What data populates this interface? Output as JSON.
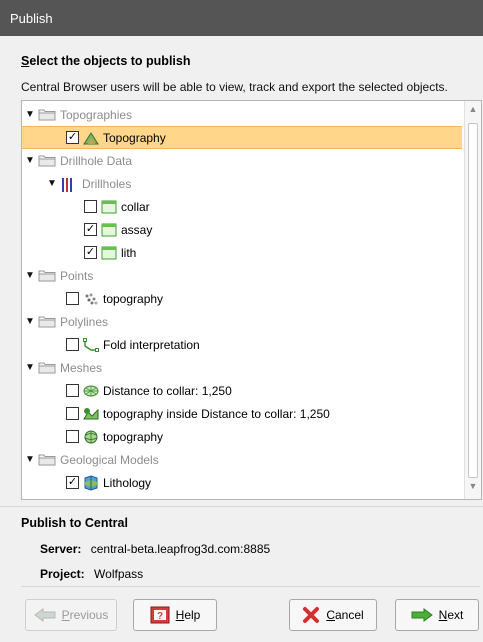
{
  "window": {
    "title": "Publish"
  },
  "heading": {
    "mnemonic": "S",
    "rest": "elect the objects to publish"
  },
  "description": "Central Browser users will be able to view, track and export the selected objects.",
  "tree": [
    {
      "type": "folder",
      "label": "Topographies",
      "indent": 0
    },
    {
      "type": "item",
      "label": "Topography",
      "indent": 2,
      "checked": true,
      "icon": "topography-icon",
      "selected": true
    },
    {
      "type": "folder",
      "label": "Drillhole Data",
      "indent": 0
    },
    {
      "type": "folder-drill",
      "label": "Drillholes",
      "indent": 1
    },
    {
      "type": "item",
      "label": "collar",
      "indent": 3,
      "checked": false,
      "icon": "table-icon"
    },
    {
      "type": "item",
      "label": "assay",
      "indent": 3,
      "checked": true,
      "icon": "table-icon"
    },
    {
      "type": "item",
      "label": "lith",
      "indent": 3,
      "checked": true,
      "icon": "table-icon"
    },
    {
      "type": "folder",
      "label": "Points",
      "indent": 0
    },
    {
      "type": "item",
      "label": "topography",
      "indent": 2,
      "checked": false,
      "icon": "points-icon"
    },
    {
      "type": "folder",
      "label": "Polylines",
      "indent": 0
    },
    {
      "type": "item",
      "label": "Fold interpretation",
      "indent": 2,
      "checked": false,
      "icon": "polyline-icon"
    },
    {
      "type": "folder",
      "label": "Meshes",
      "indent": 0
    },
    {
      "type": "item",
      "label": "Distance to collar: 1,250",
      "indent": 2,
      "checked": false,
      "icon": "mesh-icon"
    },
    {
      "type": "item",
      "label": "topography inside Distance to collar: 1,250",
      "indent": 2,
      "checked": false,
      "icon": "mesh-clip-icon"
    },
    {
      "type": "item",
      "label": "topography",
      "indent": 2,
      "checked": false,
      "icon": "mesh-topo-icon"
    },
    {
      "type": "folder",
      "label": "Geological Models",
      "indent": 0
    },
    {
      "type": "item",
      "label": "Lithology",
      "indent": 2,
      "checked": true,
      "icon": "geomodel-icon"
    }
  ],
  "publish": {
    "title": "Publish to Central",
    "server_label": "Server:",
    "server_value": "central-beta.leapfrog3d.com:8885",
    "project_label": "Project:",
    "project_value": "Wolfpass"
  },
  "buttons": {
    "previous": {
      "mnemonic": "P",
      "rest": "revious"
    },
    "help": {
      "mnemonic": "H",
      "rest": "elp"
    },
    "cancel": {
      "mnemonic": "C",
      "rest": "ancel"
    },
    "next": {
      "mnemonic": "N",
      "rest": "ext"
    }
  }
}
